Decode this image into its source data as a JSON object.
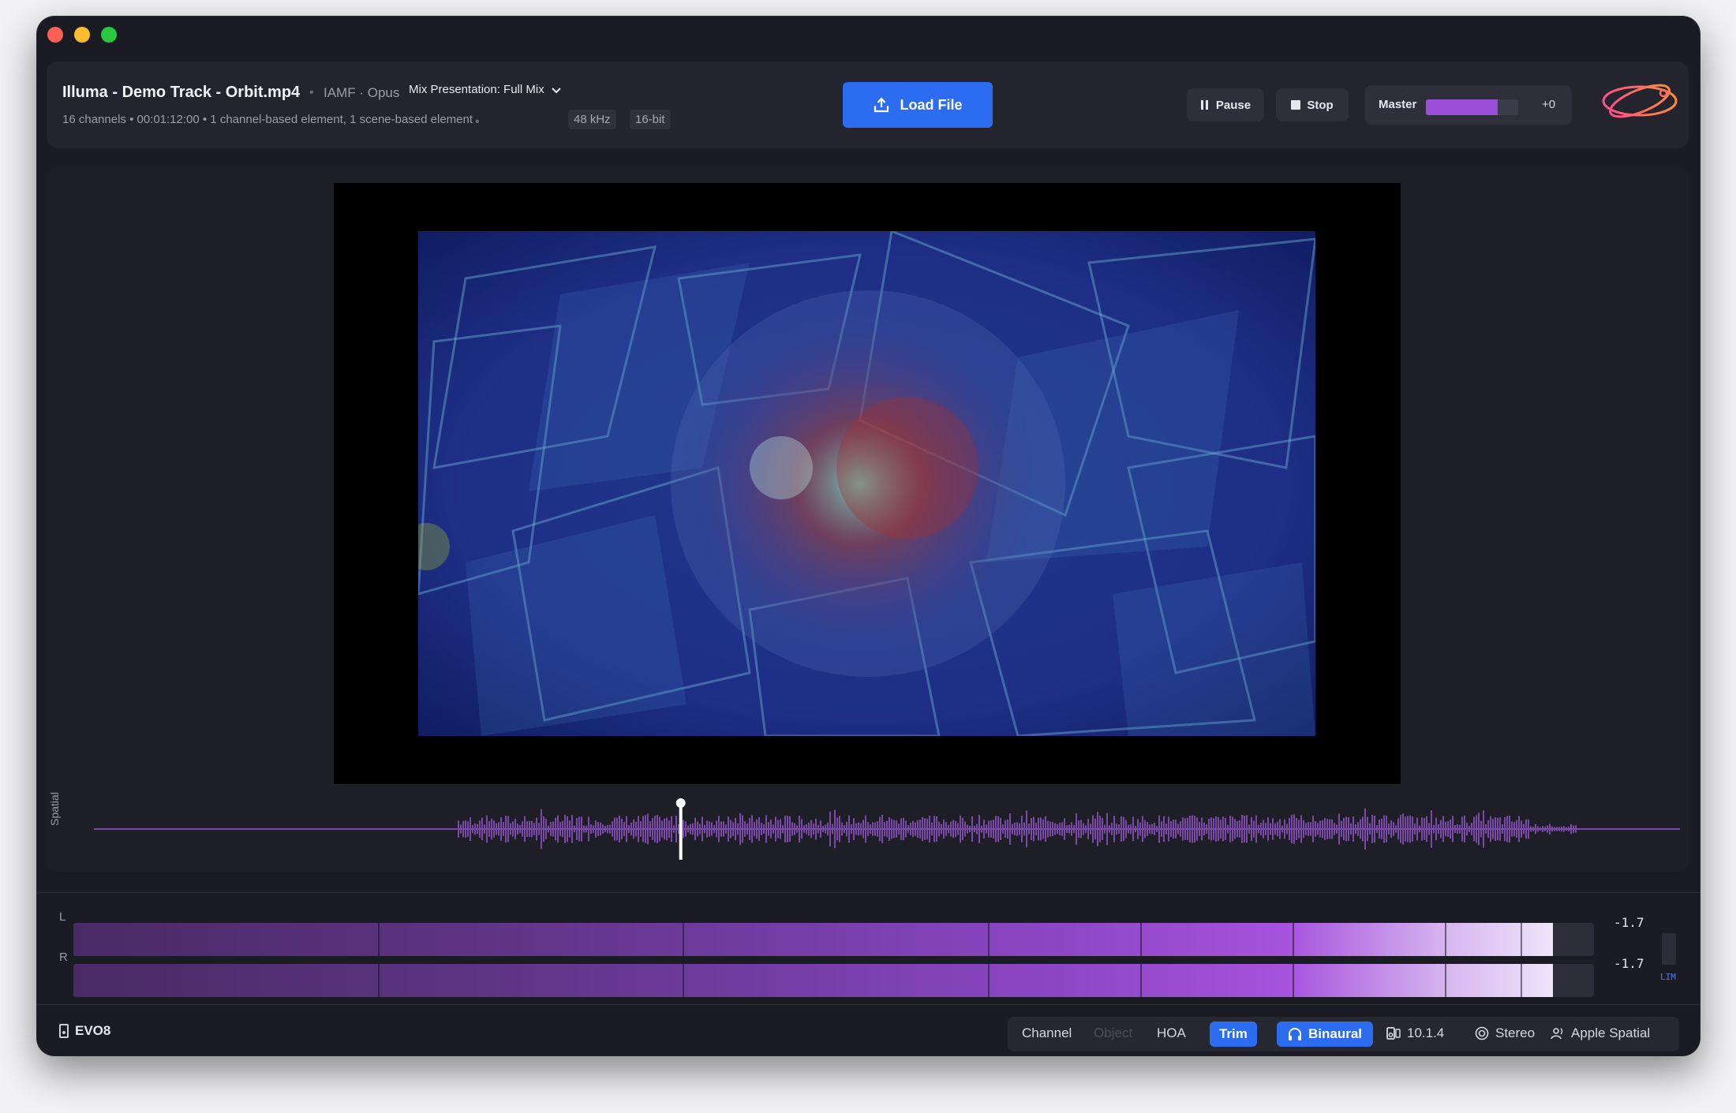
{
  "header": {
    "title": "Illuma - Demo Track - Orbit.mp4",
    "codec": "IAMF · Opus",
    "mix_presentation": "Mix Presentation: Full Mix",
    "meta": "16 channels • 00:01:12:00 • 1 channel-based element, 1 scene-based element",
    "sample_rate": "48 kHz",
    "bit_depth": "16-bit"
  },
  "controls": {
    "load_file": "Load File",
    "pause": "Pause",
    "stop": "Stop",
    "master_label": "Master",
    "master_level": 0.78,
    "master_value": "+0"
  },
  "waveform": {
    "label": "Spatial",
    "playhead_position": 0.37
  },
  "meters": {
    "left_label": "L",
    "right_label": "R",
    "left_value": "-1.7",
    "right_value": "-1.7",
    "left_level": 0.973,
    "right_level": 0.973,
    "limiter_label": "LIM"
  },
  "footer": {
    "device": "EVO8",
    "tabs": [
      "Channel",
      "Object",
      "HOA",
      "Trim"
    ],
    "render_modes": [
      "Binaural",
      "10.1.4",
      "Stereo",
      "Apple Spatial"
    ]
  },
  "colors": {
    "accent": "#2b6cf0",
    "meter_purple": "#9b4fd9",
    "waveform": "#7b4aa8"
  }
}
